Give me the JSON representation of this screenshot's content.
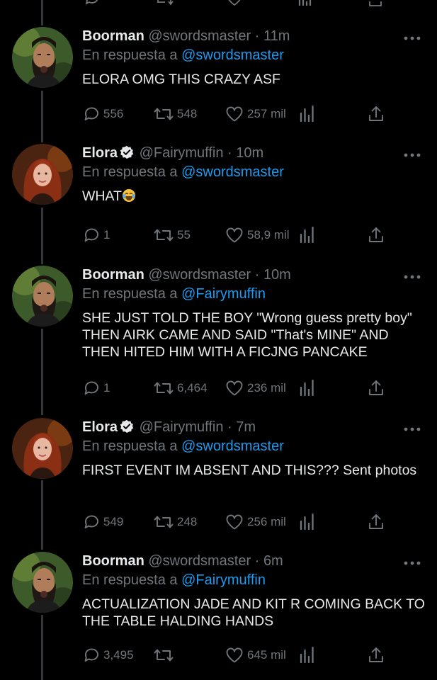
{
  "tweets": [
    {
      "name": "Boorman",
      "handle": "@swordsmaster",
      "time": "11m",
      "verified": false,
      "reply_prefix": "En respuesta a",
      "reply_to": "@swordsmaster",
      "text": "ELORA OMG THIS CRAZY ASF",
      "replies": "556",
      "retweets": "548",
      "likes": "257 mil"
    },
    {
      "name": "Elora",
      "handle": "@Fairymuffin",
      "time": "10m",
      "verified": true,
      "reply_prefix": "En respuesta a",
      "reply_to": "@swordsmaster",
      "text": "WHAT",
      "emoji": "crying-laughing-emoji",
      "replies": "1",
      "retweets": "55",
      "likes": "58,9 mil"
    },
    {
      "name": "Boorman",
      "handle": "@swordsmaster",
      "time": "10m",
      "verified": false,
      "reply_prefix": "En respuesta a",
      "reply_to": "@Fairymuffin",
      "text": "SHE JUST TOLD THE BOY \"Wrong guess pretty boy\" THEN AIRK CAME AND SAID \"That's MINE\" AND THEN HITED HIM WITH A FICJNG PANCAKE",
      "replies": "1",
      "retweets": "6,464",
      "likes": "236 mil"
    },
    {
      "name": "Elora",
      "handle": "@Fairymuffin",
      "time": "7m",
      "verified": true,
      "reply_prefix": "En respuesta a",
      "reply_to": "@swordsmaster",
      "text": "FIRST EVENT IM ABSENT AND THIS??? Sent photos",
      "replies": "549",
      "retweets": "248",
      "likes": "256 mil"
    },
    {
      "name": "Boorman",
      "handle": "@swordsmaster",
      "time": "6m",
      "verified": false,
      "reply_prefix": "En respuesta a",
      "reply_to": "@Fairymuffin",
      "text": "ACTUALIZATION JADE AND KIT R COMING BACK TO THE TABLE HALDING HANDS",
      "replies": "3,495",
      "retweets": "",
      "likes": "645 mil"
    }
  ],
  "separator": "·",
  "colors": {
    "background": "#000000",
    "text": "#e7e9ea",
    "secondary": "#71767b",
    "link": "#1d9bf0",
    "verified": "#e7e9ea"
  },
  "icons": [
    "reply-icon",
    "retweet-icon",
    "like-icon",
    "views-icon",
    "share-icon",
    "more-icon",
    "verified-icon"
  ]
}
